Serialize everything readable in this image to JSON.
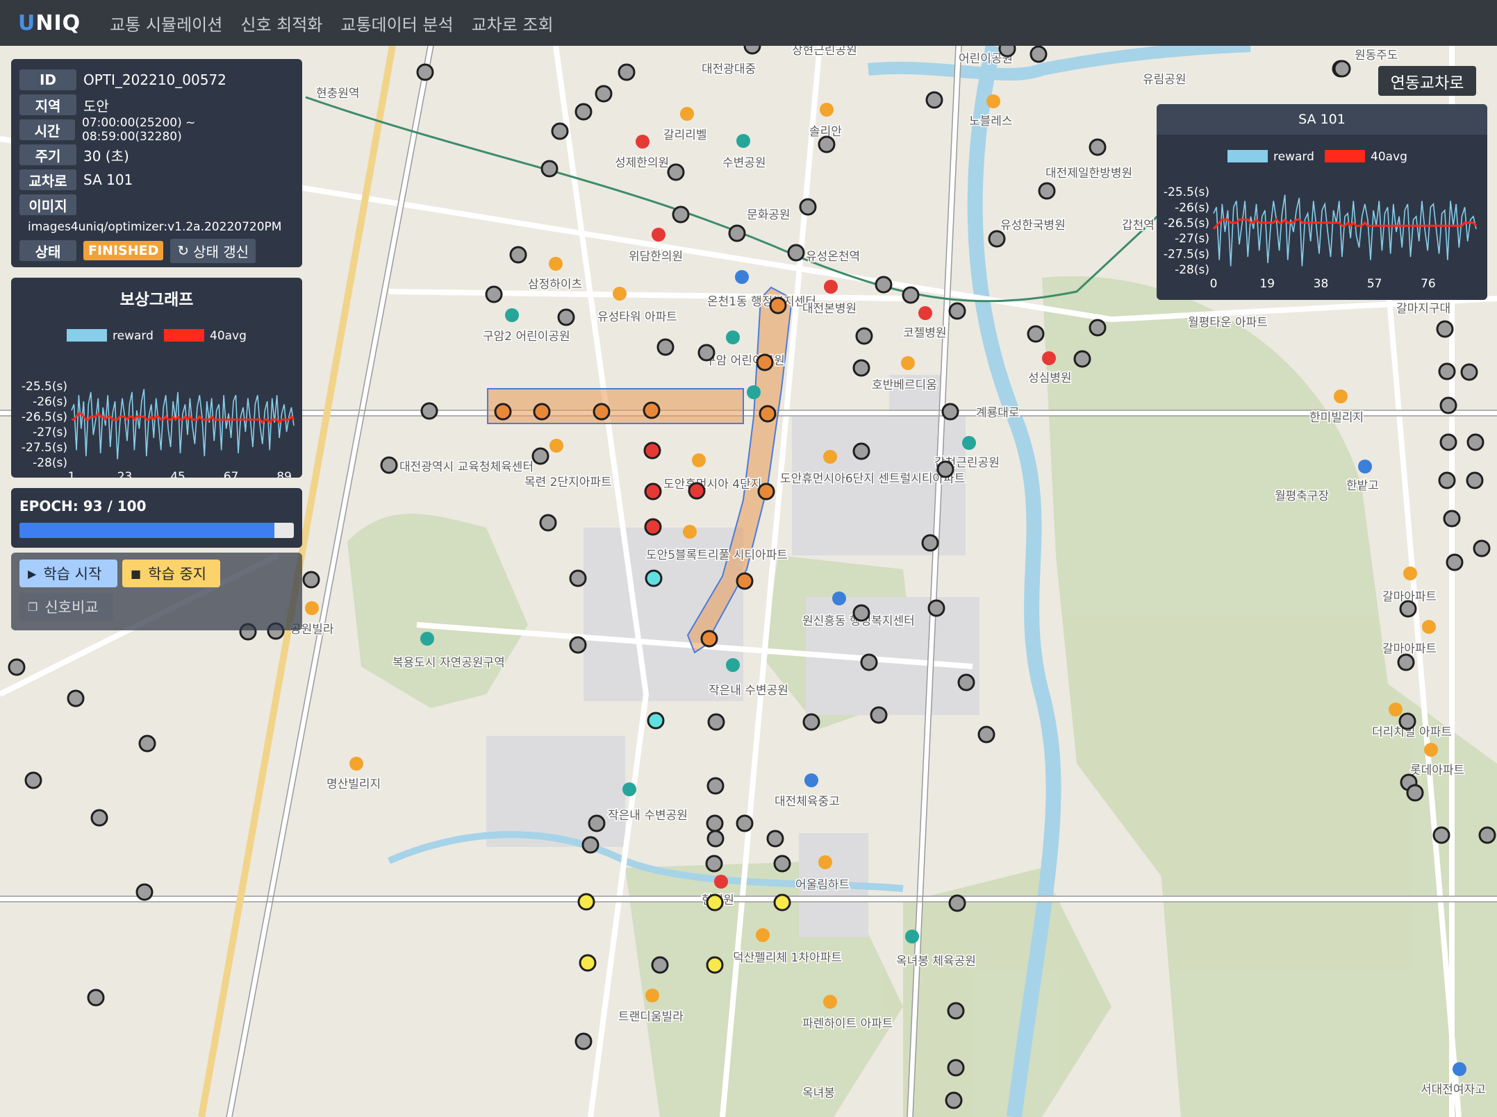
{
  "app": {
    "logo_first": "U",
    "logo_rest": "NIQ"
  },
  "nav": {
    "items": [
      "교통 시뮬레이션",
      "신호 최적화",
      "교통데이터 분석",
      "교차로 조회"
    ]
  },
  "info": {
    "rows": [
      {
        "label": "ID",
        "value": "OPTI_202210_00572"
      },
      {
        "label": "지역",
        "value": "도안"
      },
      {
        "label": "시간",
        "value": "07:00:00(25200) ~ 08:59:00(32280)"
      },
      {
        "label": "주기",
        "value": "30 (초)"
      },
      {
        "label": "교차로",
        "value": "SA 101"
      },
      {
        "label": "이미지",
        "value": ""
      }
    ],
    "image_path": "images4uniq/optimizer:v1.2a.20220720PM",
    "status_label": "상태",
    "status_value": "FINISHED",
    "refresh_label": "상태 갱신"
  },
  "reward_panel": {
    "title": "보상그래프"
  },
  "epoch": {
    "label": "EPOCH: 93 / 100",
    "current": 93,
    "total": 100
  },
  "controls": {
    "start_label": "학습 시작",
    "stop_label": "학습 중지",
    "compare_label": "신호비교"
  },
  "sa_panel": {
    "title": "SA 101"
  },
  "linked_label": "연동교차로",
  "colors": {
    "reward": "#87ceeb",
    "avg": "#ff2a1a",
    "node_default": "#9e9e9e",
    "node_orange": "#e8893a",
    "node_red": "#e53935",
    "node_cyan": "#5ee0e0",
    "node_yellow": "#f7e94a",
    "corridor": "#e89a55"
  },
  "map_labels": [
    "현충원역",
    "대전광대중",
    "장현근린공원",
    "어린이공원",
    "유림공원",
    "원동주도",
    "갈리리벨",
    "솔리안",
    "노블레스",
    "성제한의원",
    "수변공원",
    "대전제일한방병원",
    "문화공원",
    "유성한국병원",
    "갑천역",
    "위담한의원",
    "유성온천역",
    "삼정하이츠",
    "유성타워 아파트",
    "온천1동 행정복지센터",
    "대전본병원",
    "코젤병원",
    "구암2 어린이공원",
    "구암 어린이공원",
    "호반베르디움",
    "월평타운 아파트",
    "갈마지구대",
    "성심병원",
    "한미빌리지",
    "대전광역시 교육청체육센터",
    "목련 2단지아파트",
    "도안휴먼시아 4단지",
    "도안휴먼시아6단지 센트럴시티아파트",
    "갑천근린공원",
    "월평축구장",
    "한밭고",
    "도안5블록트리풀 시티아파트",
    "공원빌라",
    "갈마아파트",
    "원신흥동 행정복지센터",
    "복용도시 자연공원구역",
    "작은내 수변공원",
    "명산빌리지",
    "더리치빌 아파트",
    "롯데아파트",
    "대전체육중고",
    "작은내 수변공원",
    "어울림하트",
    "현병원",
    "덕산펠리체 1차아파트",
    "옥녀봉 체육공원",
    "트랜디움빌라",
    "파렌하이트 아파트",
    "옥녀봉",
    "서대전여자고",
    "계룡대로",
    "갈마아파트"
  ],
  "chart_data": [
    {
      "type": "line",
      "title": "보상그래프",
      "xlabel": "",
      "ylabel": "",
      "x_ticks": [
        1,
        23,
        45,
        67,
        89
      ],
      "y_ticks": [
        "-25.5(s)",
        "-26(s)",
        "-26.5(s)",
        "-27(s)",
        "-27.5(s)",
        "-28(s)"
      ],
      "ylim": [
        -28,
        -25.5
      ],
      "xlim": [
        1,
        93
      ],
      "legend": "top-center",
      "series": [
        {
          "name": "reward",
          "values": [
            -26.3,
            -26.1,
            -27.6,
            -25.8,
            -26.9,
            -26.0,
            -27.8,
            -26.1,
            -25.7,
            -27.1,
            -26.6,
            -25.9,
            -27.7,
            -26.2,
            -26.8,
            -25.8,
            -27.5,
            -26.4,
            -26.0,
            -27.9,
            -26.7,
            -25.9,
            -26.5,
            -27.3,
            -26.1,
            -25.7,
            -27.6,
            -26.3,
            -26.9,
            -26.0,
            -25.6,
            -27.8,
            -26.5,
            -26.1,
            -27.2,
            -25.9,
            -26.7,
            -27.6,
            -26.2,
            -25.8,
            -26.9,
            -27.5,
            -26.0,
            -26.6,
            -25.7,
            -27.7,
            -26.4,
            -26.1,
            -27.1,
            -25.9,
            -26.8,
            -27.4,
            -26.2,
            -25.8,
            -26.5,
            -27.8,
            -26.0,
            -26.7,
            -25.9,
            -27.3,
            -26.3,
            -26.1,
            -27.6,
            -25.8,
            -26.9,
            -26.4,
            -27.2,
            -26.0,
            -25.8,
            -27.7,
            -26.5,
            -26.2,
            -27.0,
            -25.9,
            -26.6,
            -27.5,
            -26.1,
            -25.8,
            -26.8,
            -27.4,
            -26.3,
            -26.0,
            -27.6,
            -25.9,
            -26.7,
            -25.8,
            -27.2,
            -26.4,
            -26.1,
            -27.0,
            -26.5,
            -26.2,
            -26.8
          ]
        },
        {
          "name": "40avg",
          "values": [
            -26.6,
            -26.6,
            -26.5,
            -26.4,
            -26.4,
            -26.5,
            -26.6,
            -26.6,
            -26.5,
            -26.5,
            -26.5,
            -26.4,
            -26.5,
            -26.5,
            -26.6,
            -26.5,
            -26.5,
            -26.6,
            -26.6,
            -26.6,
            -26.5,
            -26.5,
            -26.5,
            -26.6,
            -26.5,
            -26.5,
            -26.6,
            -26.5,
            -26.5,
            -26.5,
            -26.5,
            -26.6,
            -26.6,
            -26.5,
            -26.6,
            -26.5,
            -26.5,
            -26.6,
            -26.6,
            -26.5,
            -26.6,
            -26.6,
            -26.5,
            -26.6,
            -26.5,
            -26.6,
            -26.6,
            -26.5,
            -26.6,
            -26.5,
            -26.6,
            -26.6,
            -26.6,
            -26.5,
            -26.6,
            -26.6,
            -26.6,
            -26.6,
            -26.5,
            -26.6,
            -26.6,
            -26.6,
            -26.6,
            -26.6,
            -26.6,
            -26.6,
            -26.6,
            -26.6,
            -26.6,
            -26.6,
            -26.6,
            -26.6,
            -26.6,
            -26.6,
            -26.6,
            -26.6,
            -26.6,
            -26.6,
            -26.6,
            -26.7,
            -26.6,
            -26.6,
            -26.7,
            -26.6,
            -26.6,
            -26.6,
            -26.7,
            -26.6,
            -26.6,
            -26.6,
            -26.6,
            -26.5,
            -26.6
          ]
        }
      ]
    },
    {
      "type": "line",
      "title": "SA 101",
      "xlabel": "",
      "ylabel": "",
      "x_ticks": [
        0,
        19,
        38,
        57,
        76
      ],
      "y_ticks": [
        "-25.5(s)",
        "-26(s)",
        "-26.5(s)",
        "-27(s)",
        "-27.5(s)",
        "-28(s)"
      ],
      "ylim": [
        -28,
        -25.5
      ],
      "xlim": [
        0,
        93
      ],
      "legend": "top-center",
      "series": [
        {
          "name": "reward",
          "values": [
            -26.2,
            -26.0,
            -27.7,
            -25.9,
            -26.8,
            -26.1,
            -27.9,
            -26.0,
            -25.8,
            -27.2,
            -26.5,
            -25.8,
            -27.6,
            -26.3,
            -26.7,
            -25.9,
            -27.4,
            -26.3,
            -26.1,
            -27.8,
            -26.6,
            -25.8,
            -26.4,
            -27.4,
            -26.2,
            -25.6,
            -27.7,
            -26.4,
            -26.8,
            -26.1,
            -25.7,
            -27.9,
            -26.4,
            -26.2,
            -27.1,
            -25.8,
            -26.6,
            -27.5,
            -26.1,
            -25.9,
            -26.8,
            -27.6,
            -26.1,
            -26.5,
            -25.8,
            -27.6,
            -26.3,
            -26.2,
            -27.0,
            -25.8,
            -26.9,
            -27.3,
            -26.3,
            -25.9,
            -26.4,
            -27.7,
            -26.1,
            -26.6,
            -25.8,
            -27.4,
            -26.2,
            -26.0,
            -27.5,
            -25.9,
            -26.8,
            -26.3,
            -27.3,
            -26.1,
            -25.9,
            -27.6,
            -26.4,
            -26.3,
            -27.1,
            -25.8,
            -26.7,
            -27.4,
            -26.0,
            -25.9,
            -26.7,
            -27.5,
            -26.2,
            -26.1,
            -27.7,
            -25.8,
            -26.6,
            -25.9,
            -27.3,
            -26.3,
            -26.0,
            -27.1,
            -26.4,
            -26.3,
            -26.7
          ]
        },
        {
          "name": "40avg",
          "values": [
            -26.7,
            -26.6,
            -26.5,
            -26.4,
            -26.4,
            -26.4,
            -26.5,
            -26.5,
            -26.5,
            -26.4,
            -26.4,
            -26.4,
            -26.4,
            -26.5,
            -26.5,
            -26.4,
            -26.5,
            -26.5,
            -26.5,
            -26.5,
            -26.5,
            -26.5,
            -26.4,
            -26.5,
            -26.5,
            -26.4,
            -26.5,
            -26.5,
            -26.5,
            -26.4,
            -26.4,
            -26.5,
            -26.5,
            -26.5,
            -26.5,
            -26.5,
            -26.5,
            -26.5,
            -26.5,
            -26.5,
            -26.5,
            -26.5,
            -26.5,
            -26.5,
            -26.5,
            -26.6,
            -26.6,
            -26.5,
            -26.6,
            -26.5,
            -26.6,
            -26.6,
            -26.6,
            -26.5,
            -26.6,
            -26.6,
            -26.6,
            -26.6,
            -26.6,
            -26.6,
            -26.6,
            -26.6,
            -26.6,
            -26.6,
            -26.6,
            -26.6,
            -26.6,
            -26.6,
            -26.6,
            -26.6,
            -26.6,
            -26.6,
            -26.6,
            -26.6,
            -26.6,
            -26.6,
            -26.6,
            -26.6,
            -26.6,
            -26.6,
            -26.6,
            -26.6,
            -26.6,
            -26.6,
            -26.6,
            -26.6,
            -26.6,
            -26.6,
            -26.5,
            -26.5,
            -26.5,
            -26.5,
            -26.6
          ]
        }
      ]
    }
  ]
}
